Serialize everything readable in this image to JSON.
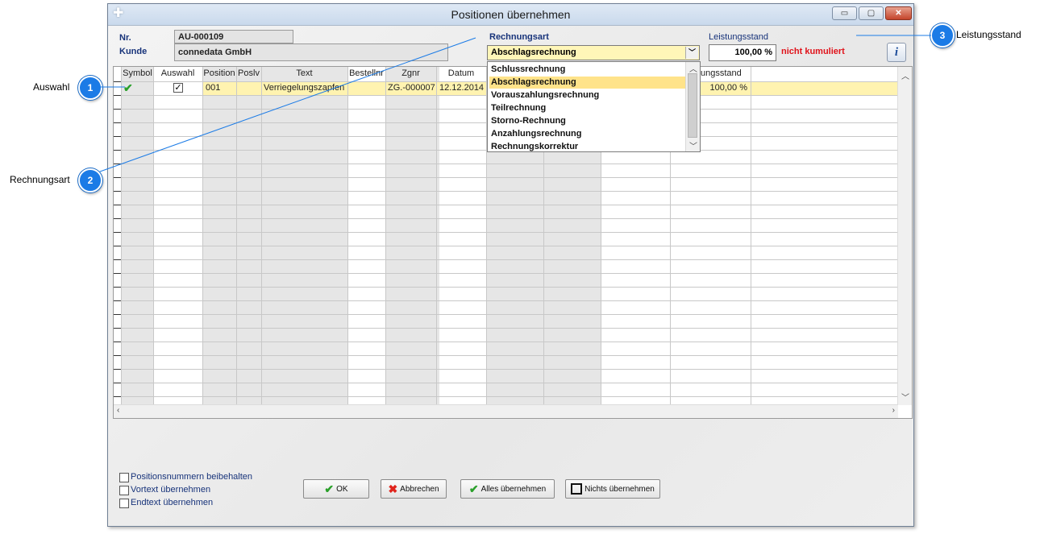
{
  "window": {
    "title": "Positionen übernehmen",
    "controls": {
      "minimize": "▭",
      "maximize": "▢",
      "close": "✕"
    }
  },
  "header": {
    "nr_label": "Nr.",
    "nr_value": "AU-000109",
    "kunde_label": "Kunde",
    "kunde_value": "connedata GmbH",
    "rechnungsart_label": "Rechnungsart",
    "rechnungsart_value": "Abschlagsrechnung",
    "leistungsstand_label": "Leistungsstand",
    "leistungsstand_value": "100,00 %",
    "kumuliert_text": "nicht kumuliert",
    "info_icon": "info-icon"
  },
  "dropdown": {
    "options": [
      "Schlussrechnung",
      "Abschlagsrechnung",
      "Vorauszahlungsrechnung",
      "Teilrechnung",
      "Storno-Rechnung",
      "Anzahlungsrechnung",
      "Rechnungskorrektur"
    ],
    "selected": "Abschlagsrechnung"
  },
  "table": {
    "columns": [
      "Symbol",
      "Auswahl",
      "Position",
      "Poslv",
      "Text",
      "Bestellnr",
      "Zgnr",
      "Datum",
      "ungsstand"
    ],
    "rows": [
      {
        "symbol": "✔",
        "auswahl": "✓",
        "position": "001",
        "poslv": "",
        "text": "Verriegelungszapfen",
        "bestellnr": "",
        "zgnr": "ZG.-000007",
        "datum": "12.12.2014",
        "leistungsstand": "100,00 %"
      }
    ]
  },
  "options": {
    "positionsnummern": "Positionsnummern beibehalten",
    "vortext": "Vortext übernehmen",
    "endtext": "Endtext übernehmen"
  },
  "buttons": {
    "ok": "OK",
    "abbrechen": "Abbrechen",
    "alles": "Alles übernehmen",
    "nichts": "Nichts übernehmen"
  },
  "callouts": [
    {
      "number": "1",
      "label": "Auswahl"
    },
    {
      "number": "2",
      "label": "Rechnungsart"
    },
    {
      "number": "3",
      "label": "Leistungsstand"
    }
  ],
  "colors": {
    "callout": "#1b7be6",
    "selected_row": "#fff3b0",
    "warning_text": "#e0121a",
    "label_blue": "#17337a"
  }
}
